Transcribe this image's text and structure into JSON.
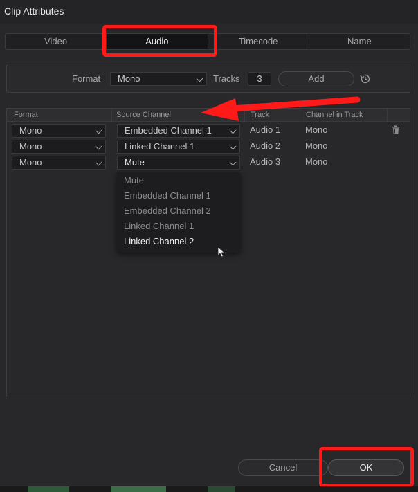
{
  "window": {
    "title": "Clip Attributes"
  },
  "tabs": [
    {
      "label": "Video",
      "active": false
    },
    {
      "label": "Audio",
      "active": true
    },
    {
      "label": "Timecode",
      "active": false
    },
    {
      "label": "Name",
      "active": false
    }
  ],
  "format_bar": {
    "format_label": "Format",
    "format_value": "Mono",
    "tracks_label": "Tracks",
    "tracks_value": "3",
    "add_label": "Add"
  },
  "table": {
    "headers": [
      "Format",
      "Source Channel",
      "Track",
      "Channel in Track"
    ],
    "rows": [
      {
        "format": "Mono",
        "source": "Embedded Channel 1",
        "track": "Audio 1",
        "channel": "Mono"
      },
      {
        "format": "Mono",
        "source": "Linked Channel 1",
        "track": "Audio 2",
        "channel": "Mono"
      },
      {
        "format": "Mono",
        "source": "Mute",
        "track": "Audio 3",
        "channel": "Mono"
      }
    ]
  },
  "dropdown": {
    "options": [
      "Mute",
      "Embedded Channel 1",
      "Embedded Channel 2",
      "Linked Channel 1",
      "Linked Channel 2"
    ],
    "hovered": "Linked Channel 2"
  },
  "footer": {
    "cancel_label": "Cancel",
    "ok_label": "OK"
  },
  "colors": {
    "highlight": "#ff1a1a",
    "background": "#28282b",
    "active_tab": "#141416"
  },
  "icons": {
    "reset": "reset-icon",
    "delete": "trash-icon",
    "cursor": "mouse-cursor-icon"
  }
}
